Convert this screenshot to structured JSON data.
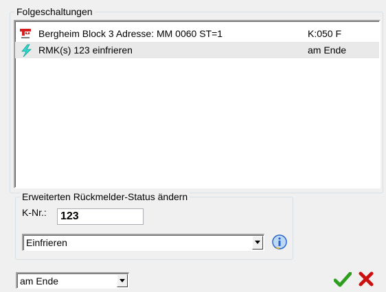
{
  "folge": {
    "title": "Folgeschaltungen",
    "rows": [
      {
        "label": "Bergheim Block 3 Adresse: MM 0060 ST=1",
        "value": "K:050 F",
        "icon": "signal-icon"
      },
      {
        "label": "RMK(s) 123 einfrieren",
        "value": "am Ende",
        "icon": "lightning-icon"
      }
    ]
  },
  "status_group": {
    "title": "Erweiterten Rückmelder-Status ändern",
    "knr_label": "K-Nr.:",
    "knr_value": "123",
    "action_value": "Einfrieren"
  },
  "timing_value": "am Ende",
  "colors": {
    "accent_green": "#2e9e1e",
    "cancel_red": "#cc1010",
    "info_blue": "#2b62c9"
  }
}
